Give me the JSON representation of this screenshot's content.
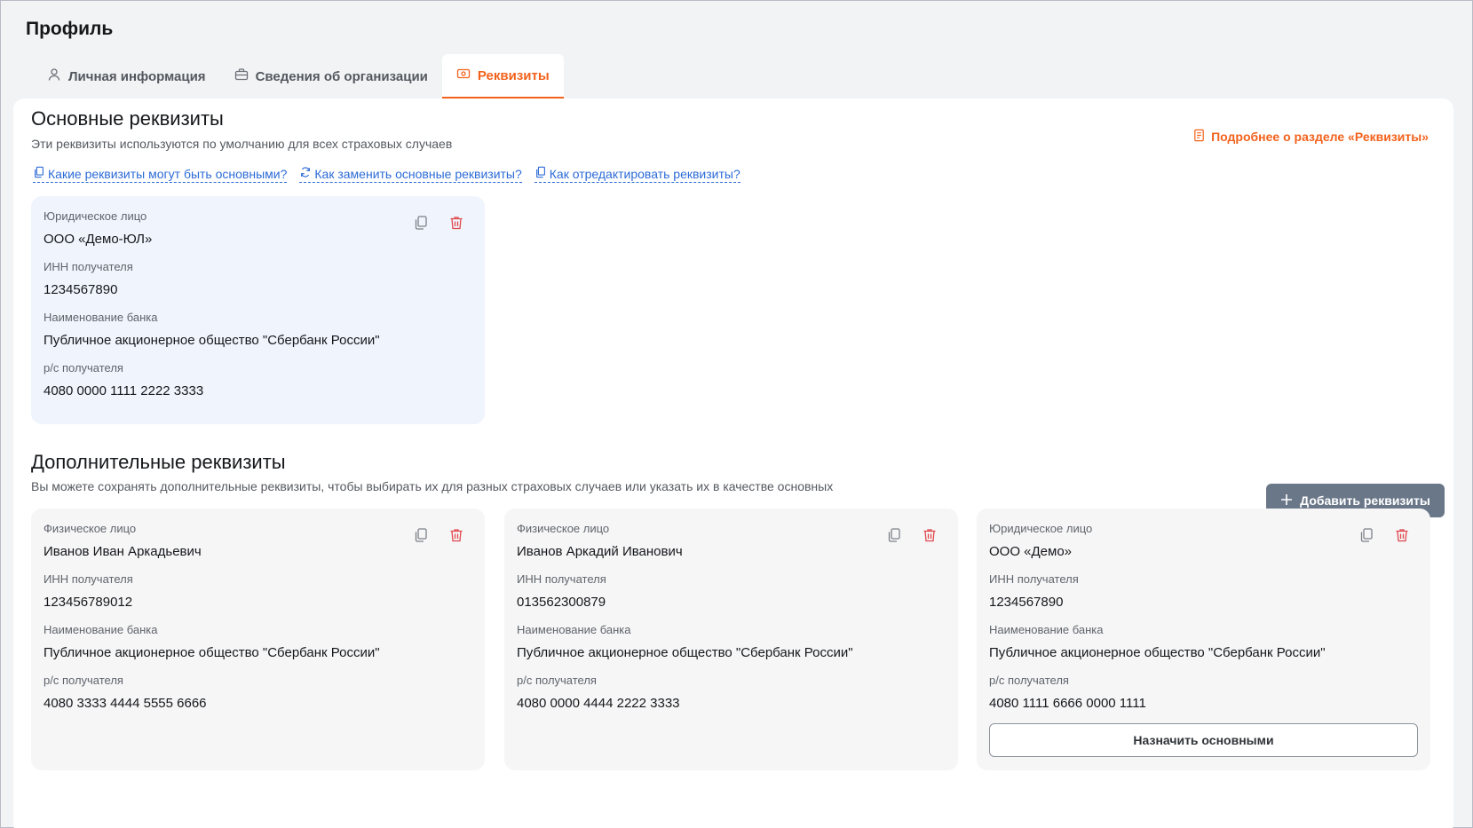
{
  "page": {
    "title": "Профиль"
  },
  "tabs": [
    {
      "label": "Личная информация",
      "icon": "user-icon",
      "active": false
    },
    {
      "label": "Сведения об организации",
      "icon": "briefcase-icon",
      "active": false
    },
    {
      "label": "Реквизиты",
      "icon": "banknote-icon",
      "active": true
    }
  ],
  "main_section": {
    "title": "Основные реквизиты",
    "subtitle": "Эти реквизиты используются по умолчанию для всех страховых случаев",
    "more_link": "Подробнее о разделе «Реквизиты»",
    "help_links": [
      {
        "label": "Какие реквизиты могут быть основными?",
        "icon": "copy-icon"
      },
      {
        "label": "Как заменить основные реквизиты?",
        "icon": "refresh-icon"
      },
      {
        "label": "Как отредактировать реквизиты?",
        "icon": "copy-icon"
      }
    ],
    "card": {
      "entity_label": "Юридическое лицо",
      "entity_value": "ООО «Демо-ЮЛ»",
      "inn_label": "ИНН получателя",
      "inn_value": "1234567890",
      "bank_label": "Наименование банка",
      "bank_value": "Публичное акционерное общество \"Сбербанк России\"",
      "account_label": "р/с получателя",
      "account_value": "4080 0000 1111 2222 3333"
    }
  },
  "extra_section": {
    "title": "Дополнительные реквизиты",
    "subtitle": "Вы можете сохранять дополнительные реквизиты, чтобы выбирать их для разных страховых случаев или указать их в качестве основных",
    "add_button": "Добавить реквизиты",
    "cards": [
      {
        "entity_label": "Физическое лицо",
        "entity_value": "Иванов Иван Аркадьевич",
        "inn_label": "ИНН получателя",
        "inn_value": "123456789012",
        "bank_label": "Наименование банка",
        "bank_value": "Публичное акционерное общество \"Сбербанк России\"",
        "account_label": "р/с получателя",
        "account_value": "4080 3333 4444 5555 6666"
      },
      {
        "entity_label": "Физическое лицо",
        "entity_value": "Иванов Аркадий Иванович",
        "inn_label": "ИНН получателя",
        "inn_value": "013562300879",
        "bank_label": "Наименование банка",
        "bank_value": "Публичное акционерное общество \"Сбербанк России\"",
        "account_label": "р/с получателя",
        "account_value": "4080 0000 4444 2222 3333"
      },
      {
        "entity_label": "Юридическое лицо",
        "entity_value": "ООО «Демо»",
        "inn_label": "ИНН получателя",
        "inn_value": "1234567890",
        "bank_label": "Наименование банка",
        "bank_value": "Публичное акционерное общество \"Сбербанк России\"",
        "account_label": "р/с получателя",
        "account_value": "4080 1111 6666 0000 1111",
        "assign_button": "Назначить основными"
      }
    ]
  },
  "colors": {
    "accent": "#f2621c",
    "link": "#2c6bd6",
    "delete": "#e0474c",
    "main_card_bg": "#f0f5fd",
    "card_bg": "#f6f6f7",
    "add_button_bg": "#6a7788"
  }
}
